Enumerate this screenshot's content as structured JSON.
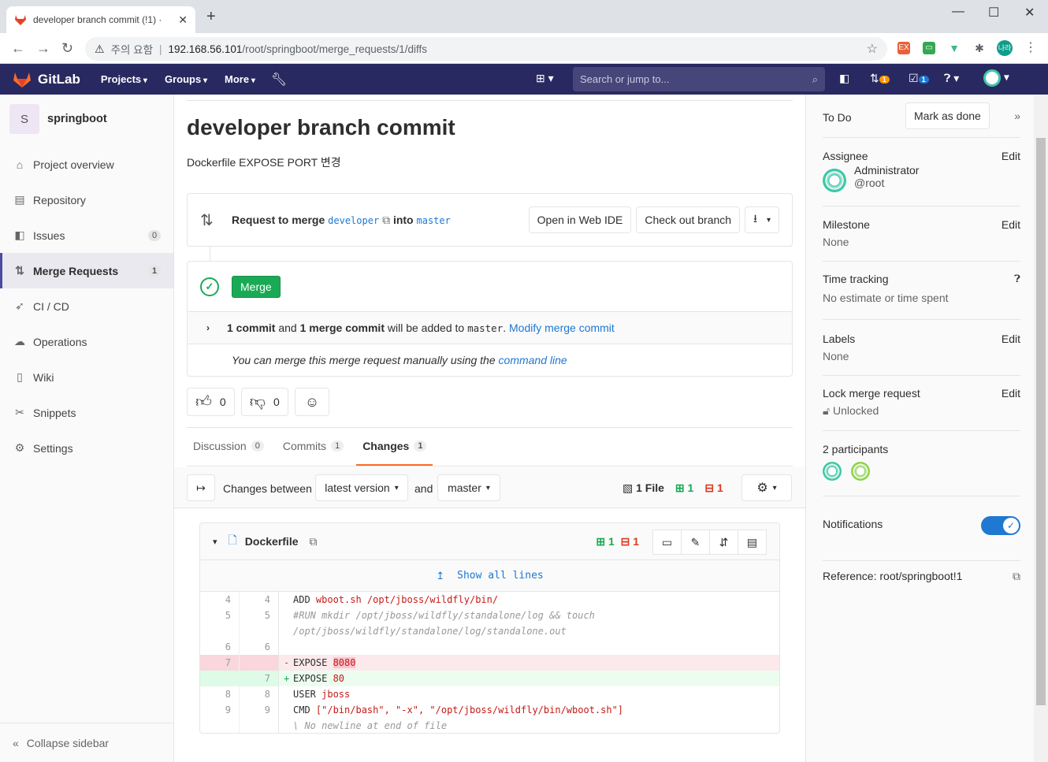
{
  "browser": {
    "tab_title": "developer branch commit (!1) ·",
    "security_label": "주의 요함",
    "url_host": "192.168.56.101",
    "url_path": "/root/springboot/merge_requests/1/diffs",
    "profile_label": "나라"
  },
  "header": {
    "brand": "GitLab",
    "nav": [
      "Projects",
      "Groups",
      "More"
    ],
    "search_placeholder": "Search or jump to...",
    "mr_count": "1",
    "todo_count": "1"
  },
  "sidebar": {
    "project_initial": "S",
    "project_name": "springboot",
    "items": [
      {
        "label": "Project overview",
        "icon": "home-icon"
      },
      {
        "label": "Repository",
        "icon": "book-icon"
      },
      {
        "label": "Issues",
        "icon": "issues-icon",
        "count": "0"
      },
      {
        "label": "Merge Requests",
        "icon": "merge-request-icon",
        "count": "1",
        "active": true
      },
      {
        "label": "CI / CD",
        "icon": "rocket-icon"
      },
      {
        "label": "Operations",
        "icon": "cloud-icon"
      },
      {
        "label": "Wiki",
        "icon": "wiki-icon"
      },
      {
        "label": "Snippets",
        "icon": "scissors-icon"
      },
      {
        "label": "Settings",
        "icon": "gear-icon"
      }
    ],
    "collapse_label": "Collapse sidebar"
  },
  "mr": {
    "title": "developer branch commit",
    "description": "Dockerfile EXPOSE PORT 변경",
    "request_label": "Request to merge",
    "source_branch": "developer",
    "into_label": "into",
    "target_branch": "master",
    "open_ide": "Open in Web IDE",
    "checkout": "Check out branch",
    "merge_button": "Merge",
    "commit_count": "1 commit",
    "and": "and",
    "merge_commit": "1 merge commit",
    "will_be_added": "will be added to",
    "modify_link": "Modify merge commit",
    "manual_text": "You can merge this merge request manually using the",
    "command_line": "command line",
    "thumbs_up": "0",
    "thumbs_down": "0"
  },
  "tabs": [
    {
      "label": "Discussion",
      "count": "0"
    },
    {
      "label": "Commits",
      "count": "1"
    },
    {
      "label": "Changes",
      "count": "1",
      "active": true
    }
  ],
  "diff_toolbar": {
    "changes_between": "Changes between",
    "version": "latest version",
    "and": "and",
    "compare": "master",
    "files": "1 File",
    "added": "1",
    "removed": "1"
  },
  "diff": {
    "filename": "Dockerfile",
    "added": "1",
    "removed": "1",
    "show_all": "Show all lines",
    "lines": [
      {
        "old": "4",
        "new": "4",
        "type": "ctx",
        "sign": " ",
        "kw": "ADD ",
        "rest": "wboot.sh /opt/jboss/wildfly/bin/",
        "style": "str"
      },
      {
        "old": "5",
        "new": "5",
        "type": "ctx",
        "sign": " ",
        "kw": "",
        "rest": "#RUN mkdir /opt/jboss/wildfly/standalone/log && touch",
        "style": "cm"
      },
      {
        "old": "",
        "new": "",
        "type": "ctx",
        "sign": " ",
        "kw": "",
        "rest": "/opt/jboss/wildfly/standalone/log/standalone.out",
        "style": "cm"
      },
      {
        "old": "6",
        "new": "6",
        "type": "ctx",
        "sign": " ",
        "kw": "",
        "rest": "",
        "style": "str"
      },
      {
        "old": "7",
        "new": "",
        "type": "old",
        "sign": "-",
        "kw": "EXPOSE ",
        "rest": "8080",
        "style": "str"
      },
      {
        "old": "",
        "new": "7",
        "type": "new",
        "sign": "+",
        "kw": "EXPOSE ",
        "rest": "80",
        "style": "str"
      },
      {
        "old": "8",
        "new": "8",
        "type": "ctx",
        "sign": " ",
        "kw": "USER ",
        "rest": "jboss",
        "style": "str"
      },
      {
        "old": "9",
        "new": "9",
        "type": "ctx",
        "sign": " ",
        "kw": "CMD ",
        "rest": "[\"/bin/bash\", \"-x\", \"/opt/jboss/wildfly/bin/wboot.sh\"]",
        "style": "str"
      },
      {
        "old": "",
        "new": "",
        "type": "ctx",
        "sign": "",
        "kw": "",
        "rest": "\\ No newline at end of file",
        "style": "cm"
      }
    ]
  },
  "right": {
    "todo": "To Do",
    "mark_done": "Mark as done",
    "assignee_title": "Assignee",
    "edit": "Edit",
    "assignee_name": "Administrator",
    "assignee_user": "@root",
    "milestone_title": "Milestone",
    "milestone_value": "None",
    "time_title": "Time tracking",
    "time_value": "No estimate or time spent",
    "labels_title": "Labels",
    "labels_value": "None",
    "lock_title": "Lock merge request",
    "lock_value": "Unlocked",
    "participants": "2 participants",
    "notifications": "Notifications",
    "reference": "Reference: root/springboot!1"
  }
}
